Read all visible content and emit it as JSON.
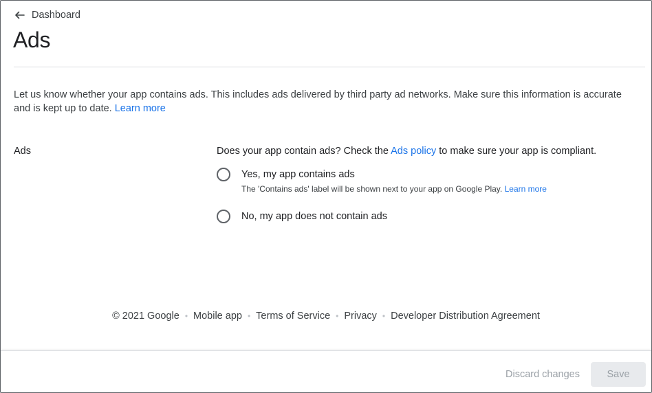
{
  "nav": {
    "back_label": "Dashboard"
  },
  "page": {
    "title": "Ads"
  },
  "intro": {
    "text": "Let us know whether your app contains ads. This includes ads delivered by third party ad networks. Make sure this information is accurate and is kept up to date.",
    "link": "Learn more"
  },
  "section": {
    "label": "Ads",
    "question_before": "Does your app contain ads? Check the",
    "question_link": "Ads policy",
    "question_after": "to make sure your app is compliant.",
    "options": [
      {
        "label": "Yes, my app contains ads",
        "help": "The 'Contains ads' label will be shown next to your app on Google Play.",
        "help_link": "Learn more"
      },
      {
        "label": "No, my app does not contain ads"
      }
    ]
  },
  "footer": {
    "copyright": "© 2021 Google",
    "links": [
      "Mobile app",
      "Terms of Service",
      "Privacy",
      "Developer Distribution Agreement"
    ]
  },
  "actions": {
    "discard_label": "Discard changes",
    "save_label": "Save"
  },
  "colors": {
    "link": "#1a73e8",
    "text": "#202124",
    "disabled": "#9aa0a6"
  }
}
